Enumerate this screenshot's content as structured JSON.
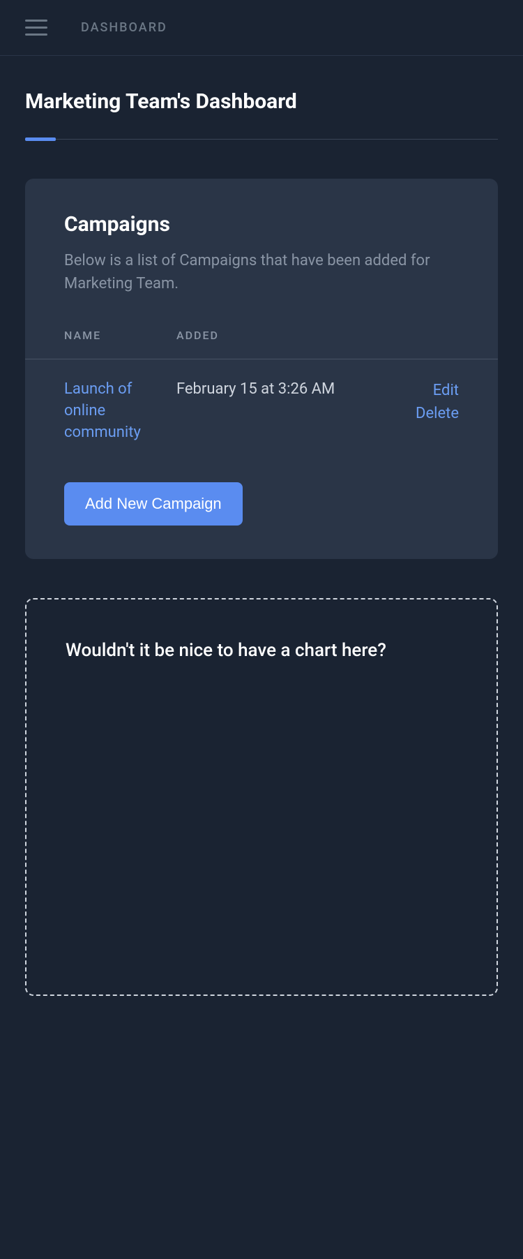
{
  "header": {
    "nav_label": "DASHBOARD"
  },
  "page": {
    "title": "Marketing Team's Dashboard"
  },
  "campaigns_card": {
    "title": "Campaigns",
    "description": "Below is a list of Campaigns that have been added for Marketing Team.",
    "columns": {
      "name": "NAME",
      "added": "ADDED"
    },
    "rows": [
      {
        "name": "Launch of online community",
        "added": "February 15 at 3:26 AM",
        "edit_label": "Edit",
        "delete_label": "Delete"
      }
    ],
    "add_button_label": "Add New Campaign"
  },
  "chart_placeholder": {
    "text": "Wouldn't it be nice to have a chart here?"
  }
}
